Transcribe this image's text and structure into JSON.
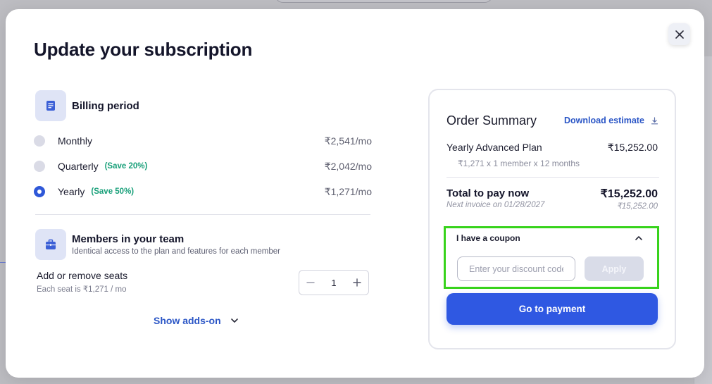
{
  "modal": {
    "title": "Update your subscription"
  },
  "billing": {
    "title": "Billing period",
    "options": [
      {
        "label": "Monthly",
        "badge": "",
        "price": "₹2,541/mo",
        "selected": false
      },
      {
        "label": "Quarterly",
        "badge": "(Save 20%)",
        "price": "₹2,042/mo",
        "selected": false
      },
      {
        "label": "Yearly",
        "badge": "(Save 50%)",
        "price": "₹1,271/mo",
        "selected": true
      }
    ]
  },
  "members": {
    "title": "Members in your team",
    "subtitle": "Identical access to the plan and features for each member",
    "seats_label": "Add or remove seats",
    "seats_sub": "Each seat is ₹1,271 / mo",
    "seats_value": "1",
    "show_addons": "Show adds-on"
  },
  "summary": {
    "title": "Order Summary",
    "download": "Download estimate",
    "plan_name": "Yearly Advanced Plan",
    "plan_price": "₹15,252.00",
    "plan_detail": "₹1,271 x 1 member x 12 months",
    "total_label": "Total to pay now",
    "total_price": "₹15,252.00",
    "next_invoice": "Next invoice on 01/28/2027",
    "next_price": "₹15,252.00"
  },
  "coupon": {
    "label": "I have a coupon",
    "placeholder": "Enter your discount code",
    "value": "",
    "apply": "Apply"
  },
  "payment": {
    "button": "Go to payment"
  },
  "colors": {
    "accent": "#2f58e2",
    "save_badge": "#19a07a",
    "highlight": "#38d31c"
  }
}
